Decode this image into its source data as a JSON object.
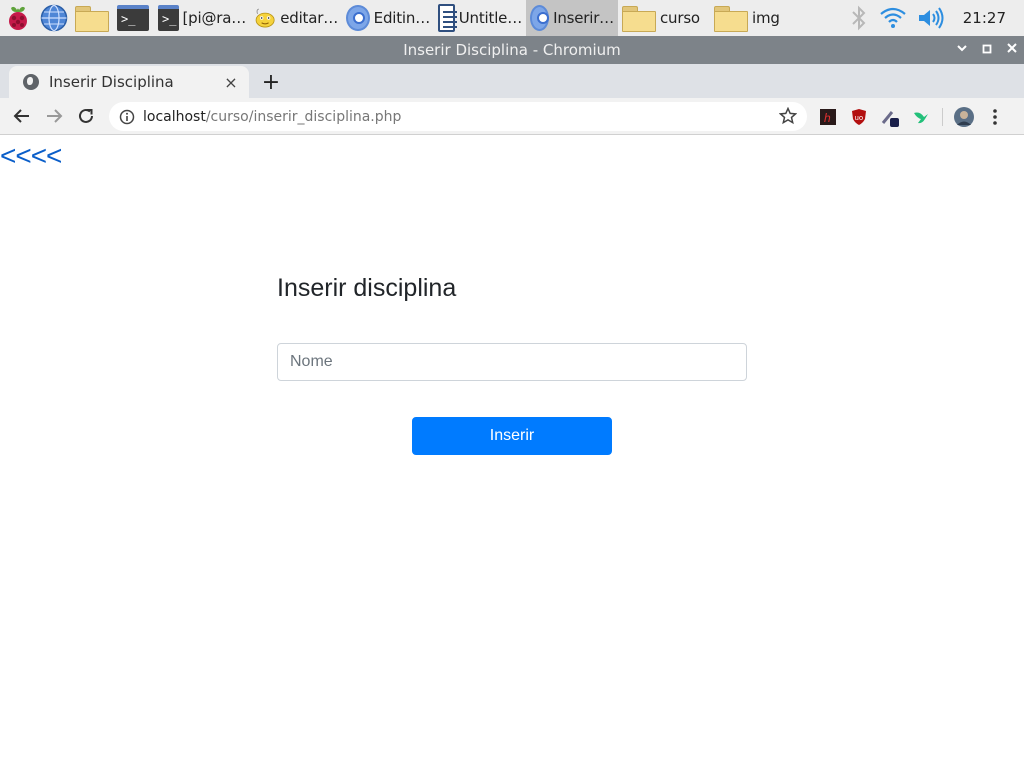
{
  "taskbar": {
    "tasks": [
      {
        "label": "[pi@ra…",
        "icon": "terminal-icon"
      },
      {
        "label": "editar…",
        "icon": "text-editor-icon"
      },
      {
        "label": "Editin…",
        "icon": "chromium-icon"
      },
      {
        "label": "Untitle…",
        "icon": "document-icon"
      },
      {
        "label": "Inserir…",
        "icon": "chromium-icon"
      },
      {
        "label": "curso",
        "icon": "folder-icon"
      },
      {
        "label": "img",
        "icon": "folder-icon"
      }
    ],
    "clock": "21:27"
  },
  "window": {
    "title": "Inserir Disciplina - Chromium"
  },
  "browser": {
    "tab_title": "Inserir Disciplina",
    "tab_close": "×",
    "new_tab": "+",
    "url_host": "localhost",
    "url_path": "/curso/inserir_disciplina.php"
  },
  "page": {
    "back_link": "<<<<",
    "form_title": "Inserir disciplina",
    "name_placeholder": "Nome",
    "name_value": "",
    "submit_label": "Inserir",
    "accent_color": "#007bff"
  }
}
